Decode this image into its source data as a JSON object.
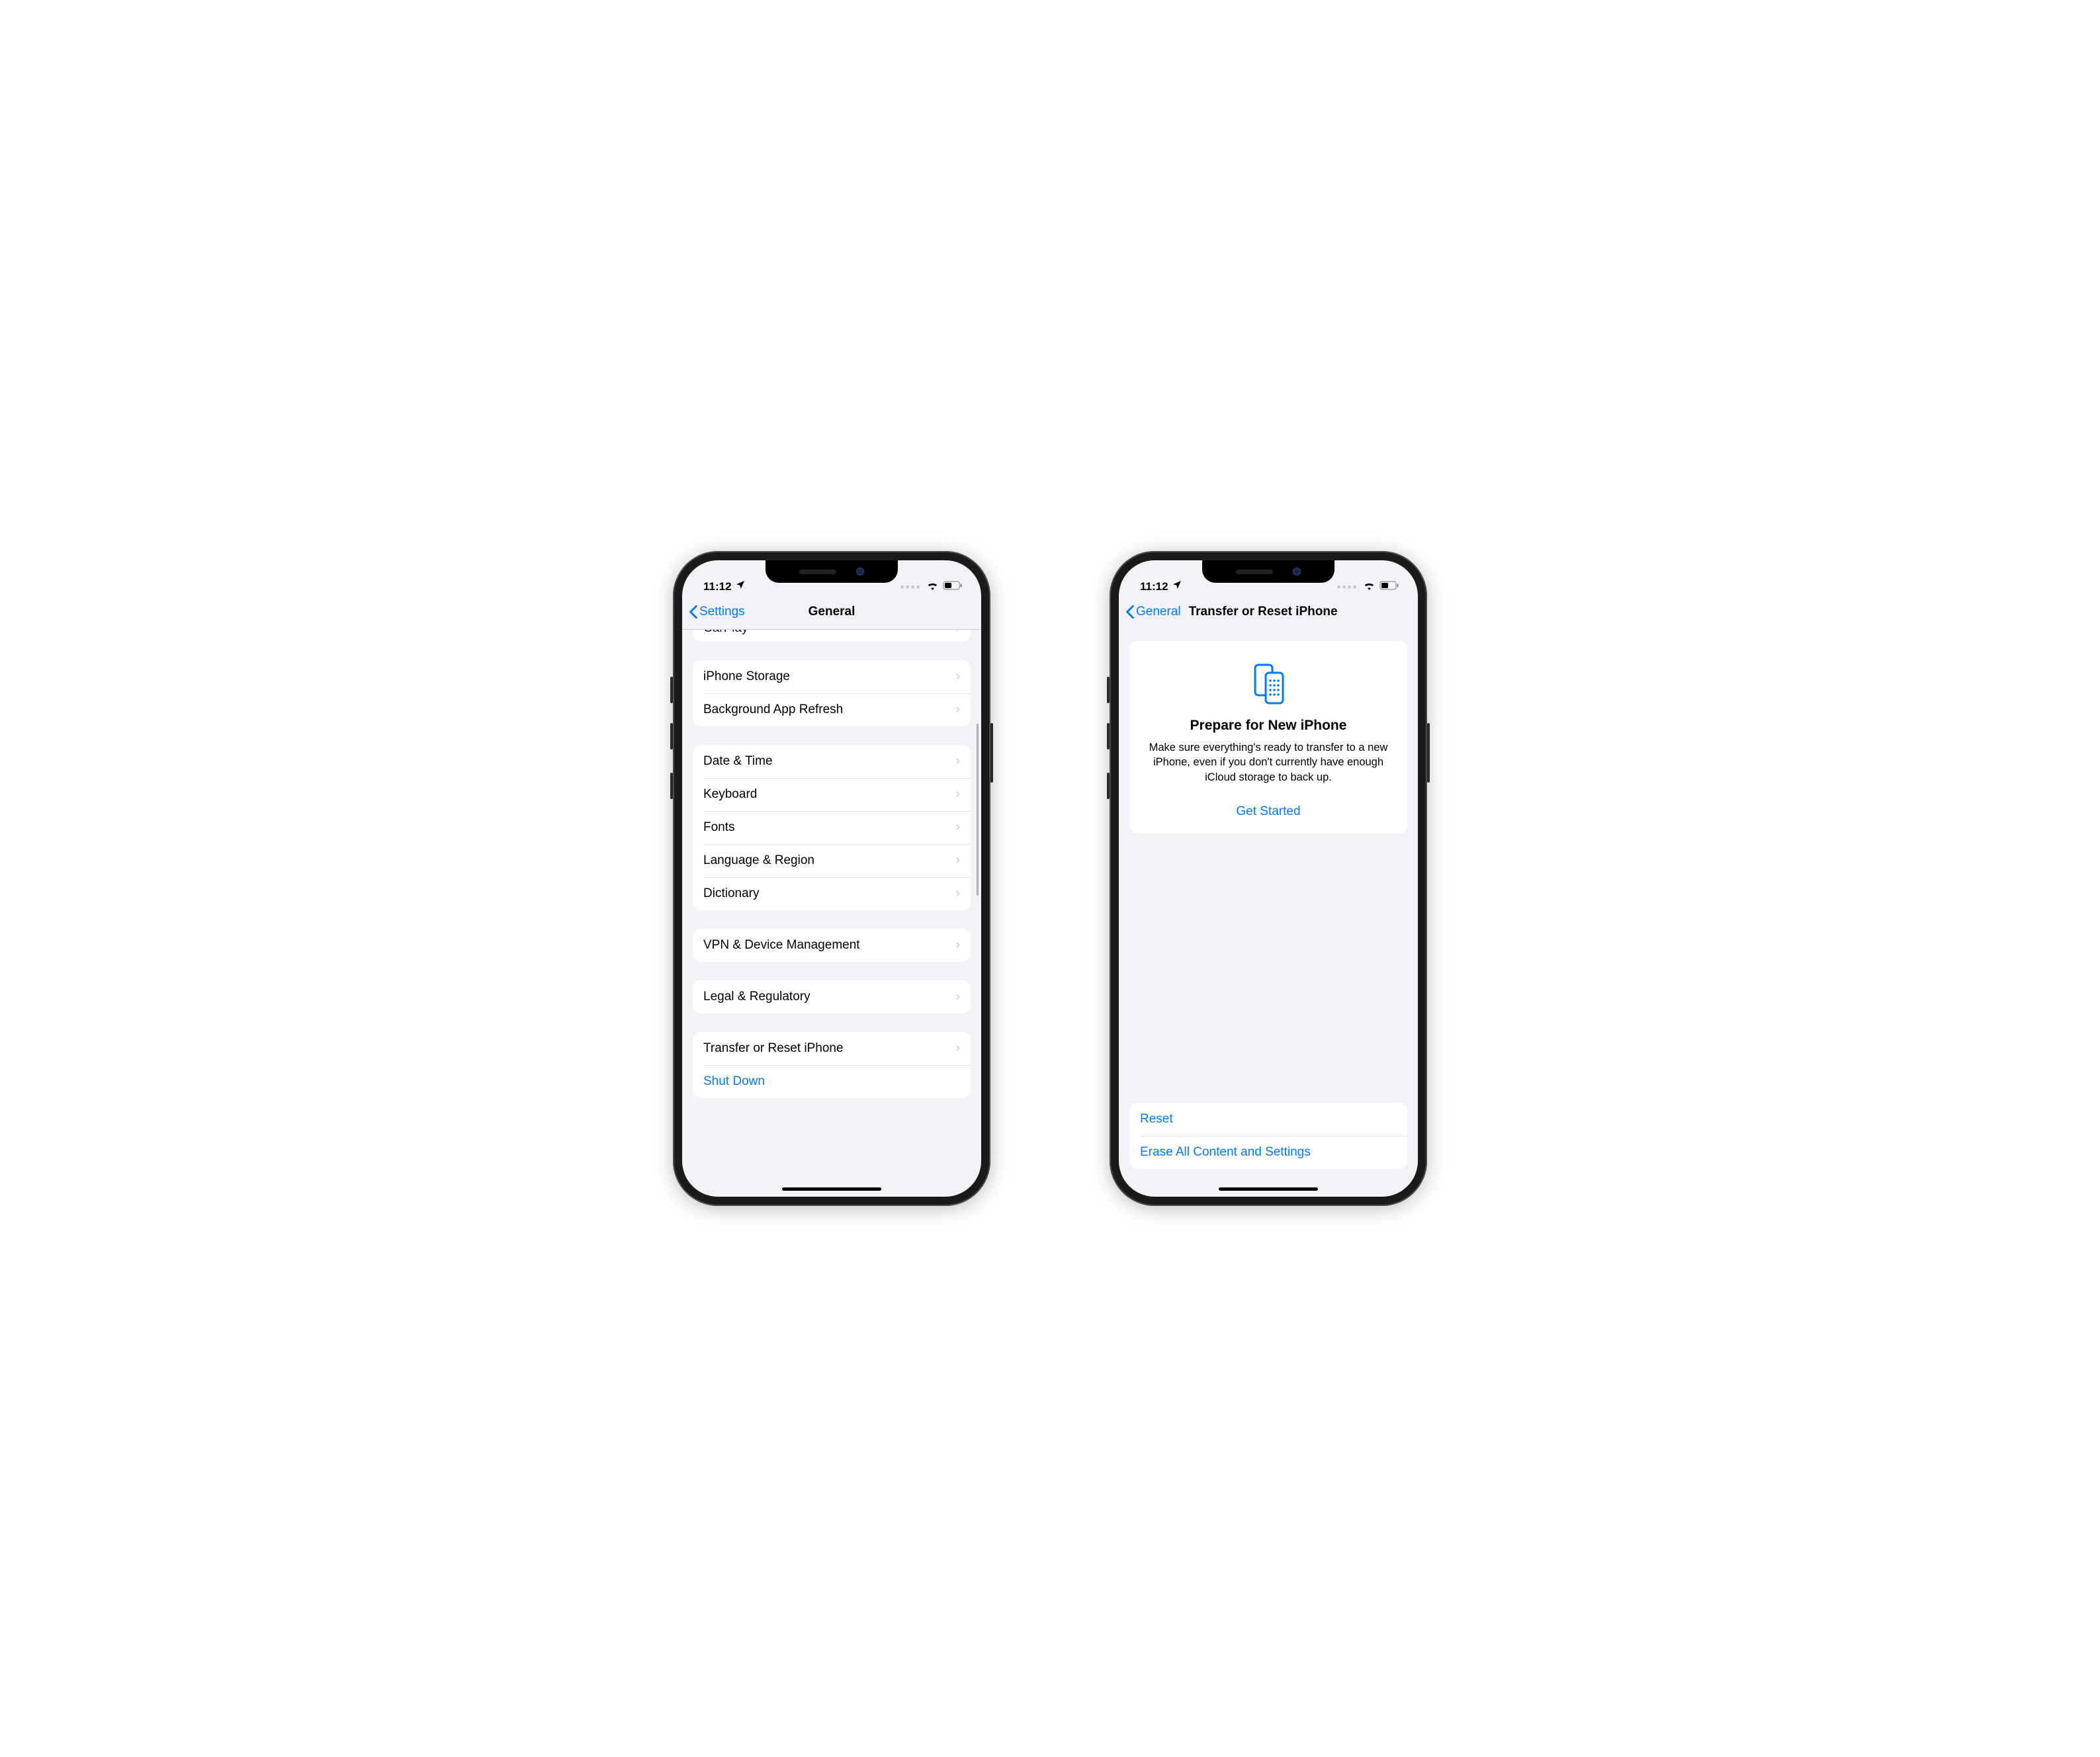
{
  "status": {
    "time": "11:12"
  },
  "left_phone": {
    "nav": {
      "back": "Settings",
      "title": "General"
    },
    "peek_row": "CarPlay",
    "group_a": [
      "iPhone Storage",
      "Background App Refresh"
    ],
    "group_b": [
      "Date & Time",
      "Keyboard",
      "Fonts",
      "Language & Region",
      "Dictionary"
    ],
    "group_c": [
      "VPN & Device Management"
    ],
    "group_d": [
      "Legal & Regulatory"
    ],
    "group_e": {
      "row": "Transfer or Reset iPhone",
      "link": "Shut Down"
    }
  },
  "right_phone": {
    "nav": {
      "back": "General",
      "title": "Transfer or Reset iPhone"
    },
    "hero": {
      "heading": "Prepare for New iPhone",
      "body": "Make sure everything's ready to transfer to a new iPhone, even if you don't currently have enough iCloud storage to back up.",
      "cta": "Get Started"
    },
    "bottom": {
      "reset": "Reset",
      "erase": "Erase All Content and Settings"
    }
  }
}
